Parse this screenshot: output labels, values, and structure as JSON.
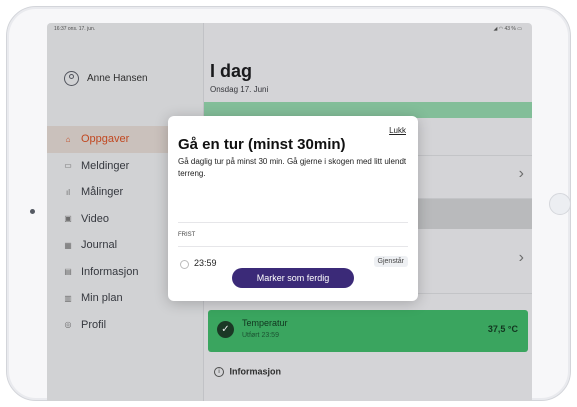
{
  "status_bar": {
    "left": "16:37  ons. 17. jun.",
    "right": "◢ ◠ 43 % ▭"
  },
  "sidebar": {
    "user_name": "Anne Hansen",
    "items": [
      {
        "label": "Oppgaver",
        "icon": "⌂",
        "icon_name": "home-icon",
        "active": true
      },
      {
        "label": "Meldinger",
        "icon": "▭",
        "icon_name": "message-icon",
        "active": false
      },
      {
        "label": "Målinger",
        "icon": "ıl",
        "icon_name": "bar-chart-icon",
        "active": false
      },
      {
        "label": "Video",
        "icon": "▣",
        "icon_name": "video-icon",
        "active": false
      },
      {
        "label": "Journal",
        "icon": "▦",
        "icon_name": "journal-icon",
        "active": false
      },
      {
        "label": "Informasjon",
        "icon": "▤",
        "icon_name": "info-doc-icon",
        "active": false
      },
      {
        "label": "Min plan",
        "icon": "▥",
        "icon_name": "plan-icon",
        "active": false
      },
      {
        "label": "Profil",
        "icon": "◎",
        "icon_name": "profile-icon",
        "active": false
      }
    ]
  },
  "main": {
    "title": "I dag",
    "date": "Onsdag 17. Juni",
    "temperature": {
      "title": "Temperatur",
      "subtitle": "Utført 23:59",
      "value": "37,5 °C"
    },
    "info_title": "Informasjon"
  },
  "modal": {
    "close_label": "Lukk",
    "title": "Gå en tur (minst 30min)",
    "description": "Gå daglig tur på minst 30 min. Gå gjerne i skogen med litt ulendt terreng.",
    "deadline_label": "FRIST",
    "deadline_time": "23:59",
    "remaining_badge": "Gjenstår",
    "done_button": "Marker som ferdig"
  },
  "colors": {
    "accent": "#d24f24",
    "primary_button": "#3b2a78",
    "success": "#3fb368"
  }
}
